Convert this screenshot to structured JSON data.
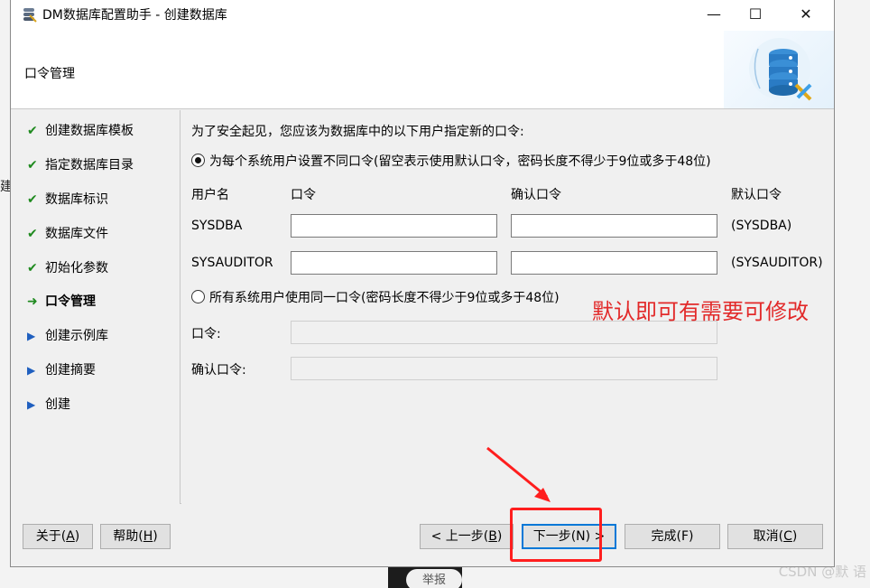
{
  "background": {
    "left_fragment": "建",
    "pill_text": "举报",
    "watermark": "CSDN @默  语"
  },
  "window": {
    "title": "DM数据库配置助手 - 创建数据库",
    "controls": {
      "minimize": "—",
      "maximize": "☐",
      "close": "✕"
    }
  },
  "header": {
    "title": "口令管理"
  },
  "steps": [
    {
      "label": "创建数据库模板",
      "state": "done"
    },
    {
      "label": "指定数据库目录",
      "state": "done"
    },
    {
      "label": "数据库标识",
      "state": "done"
    },
    {
      "label": "数据库文件",
      "state": "done"
    },
    {
      "label": "初始化参数",
      "state": "done"
    },
    {
      "label": "口令管理",
      "state": "current"
    },
    {
      "label": "创建示例库",
      "state": "pending"
    },
    {
      "label": "创建摘要",
      "state": "pending"
    },
    {
      "label": "创建",
      "state": "pending"
    }
  ],
  "content": {
    "intro": "为了安全起见，您应该为数据库中的以下用户指定新的口令:",
    "option_separate": "为每个系统用户设置不同口令(留空表示使用默认口令，密码长度不得少于9位或多于48位)",
    "columns": {
      "user": "用户名",
      "password": "口令",
      "confirm": "确认口令",
      "default": "默认口令"
    },
    "users": [
      {
        "name": "SYSDBA",
        "password": "",
        "confirm": "",
        "default": "(SYSDBA)"
      },
      {
        "name": "SYSAUDITOR",
        "password": "",
        "confirm": "",
        "default": "(SYSAUDITOR)"
      }
    ],
    "option_same": "所有系统用户使用同一口令(密码长度不得少于9位或多于48位)",
    "same_password_label": "口令:",
    "same_confirm_label": "确认口令:",
    "same_password": "",
    "same_confirm": ""
  },
  "annotation": {
    "text": "默认即可有需要可修改",
    "color": "#e22a2a"
  },
  "footer": {
    "about": {
      "text": "关于(",
      "key": "A",
      "tail": ")"
    },
    "help": {
      "text": "帮助(",
      "key": "H",
      "tail": ")"
    },
    "prev": {
      "text": "< 上一步(",
      "key": "B",
      "tail": ")"
    },
    "next": {
      "text": "下一步(N) >"
    },
    "finish": {
      "text": "完成(F)"
    },
    "cancel": {
      "text": "取消(",
      "key": "C",
      "tail": ")"
    }
  },
  "colors": {
    "done_check": "#1f8a1f",
    "pending_arrow": "#1f5fbf",
    "highlight": "#ff1e1e",
    "primary_border": "#0078d7"
  },
  "icons": {
    "done": "check-icon",
    "current": "arrow-right-icon",
    "pending": "triangle-right-icon"
  }
}
